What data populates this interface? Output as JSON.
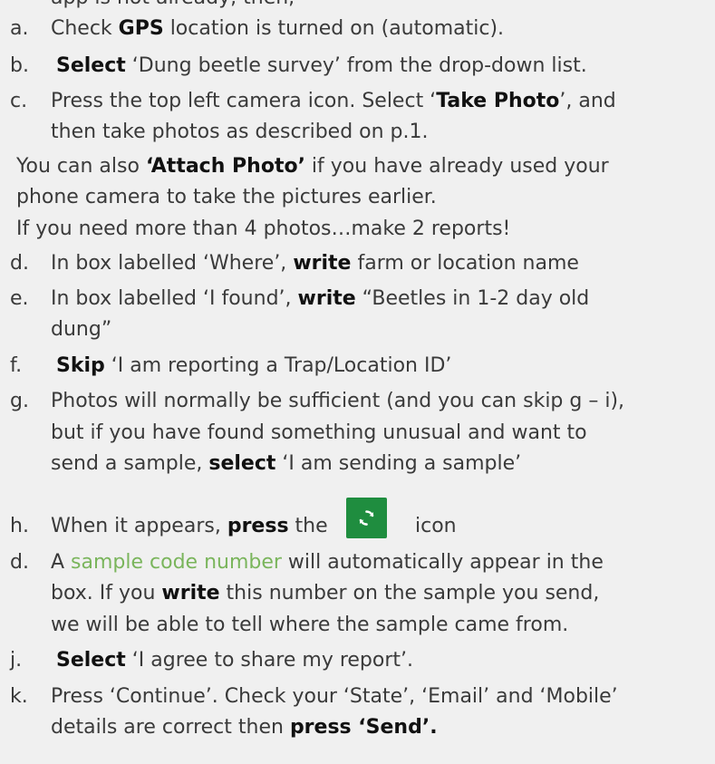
{
  "top_line": "app is not already, then,",
  "items": [
    {
      "label": "a.",
      "parts": [
        {
          "text": "Check ",
          "style": ""
        },
        {
          "text": "GPS",
          "style": "b"
        },
        {
          "text": " location is turned on (automatic).",
          "style": ""
        }
      ]
    },
    {
      "label": "b.",
      "parts": [
        {
          "text": "Select",
          "style": "b"
        },
        {
          "text": " ‘Dung beetle survey’ from the drop-down list.",
          "style": ""
        }
      ]
    },
    {
      "label": "c.",
      "line1": [
        {
          "text": "Press the top left camera icon. Select ‘",
          "style": ""
        },
        {
          "text": "Take Photo",
          "style": "b"
        },
        {
          "text": "’, and",
          "style": ""
        }
      ],
      "line2": "then take photos as described on p.1."
    },
    {
      "note1": [
        {
          "text": "You can also ",
          "style": ""
        },
        {
          "text": "‘Attach Photo’",
          "style": "b"
        },
        {
          "text": " if you have already used your",
          "style": ""
        }
      ],
      "note2": "phone camera to take the pictures earlier.",
      "note3": "If you need more than 4 photos…make 2 reports!"
    },
    {
      "label": "d.",
      "parts": [
        {
          "text": "In box labelled ‘Where’, ",
          "style": ""
        },
        {
          "text": "write",
          "style": "b"
        },
        {
          "text": " farm or location name",
          "style": ""
        }
      ]
    },
    {
      "label": "e.",
      "line1": [
        {
          "text": "In box labelled ‘I found’, ",
          "style": ""
        },
        {
          "text": "write",
          "style": "b"
        },
        {
          "text": " “Beetles in 1-2 day old",
          "style": ""
        }
      ],
      "line2": "dung”"
    },
    {
      "label": "f.",
      "parts": [
        {
          "text": "Skip",
          "style": "b"
        },
        {
          "text": " ‘I am reporting a Trap/Location ID’",
          "style": ""
        }
      ]
    },
    {
      "label": "g.",
      "line1": "Photos will normally be sufficient (and you can skip g – i),",
      "line2": "but if you have found something unusual and want to",
      "line3": [
        {
          "text": "send a sample, ",
          "style": ""
        },
        {
          "text": "select",
          "style": "b"
        },
        {
          "text": " ‘I am sending a sample’",
          "style": ""
        }
      ]
    },
    {
      "label": "h.",
      "before": [
        {
          "text": "When it appears, ",
          "style": ""
        },
        {
          "text": "press",
          "style": "b"
        },
        {
          "text": " the",
          "style": ""
        }
      ],
      "after": "icon",
      "icon": "sync-icon"
    },
    {
      "label": "d.",
      "line1": [
        {
          "text": "A ",
          "style": ""
        },
        {
          "text": "sample code number",
          "style": "g"
        },
        {
          "text": " will automatically appear in the",
          "style": ""
        }
      ],
      "line2": [
        {
          "text": "box. If you ",
          "style": ""
        },
        {
          "text": "write",
          "style": "b"
        },
        {
          "text": " this number on the sample you send,",
          "style": ""
        }
      ],
      "line3": "we will be able to tell where the sample came from."
    },
    {
      "label": "j.",
      "parts": [
        {
          "text": "Select",
          "style": "b"
        },
        {
          "text": " ‘I agree to share my report’.",
          "style": ""
        }
      ]
    },
    {
      "label": "k.",
      "line1": "Press ‘Continue’. Check your ‘State’, ‘Email’ and ‘Mobile’",
      "line2": [
        {
          "text": "details are correct then ",
          "style": ""
        },
        {
          "text": "press ‘Send’.",
          "style": "b"
        }
      ]
    }
  ],
  "colors": {
    "text": "#3a3a3a",
    "bold": "#111111",
    "green_text": "#7ab55c",
    "icon_bg": "#1f8d3f",
    "background": "#f0f0f0"
  }
}
